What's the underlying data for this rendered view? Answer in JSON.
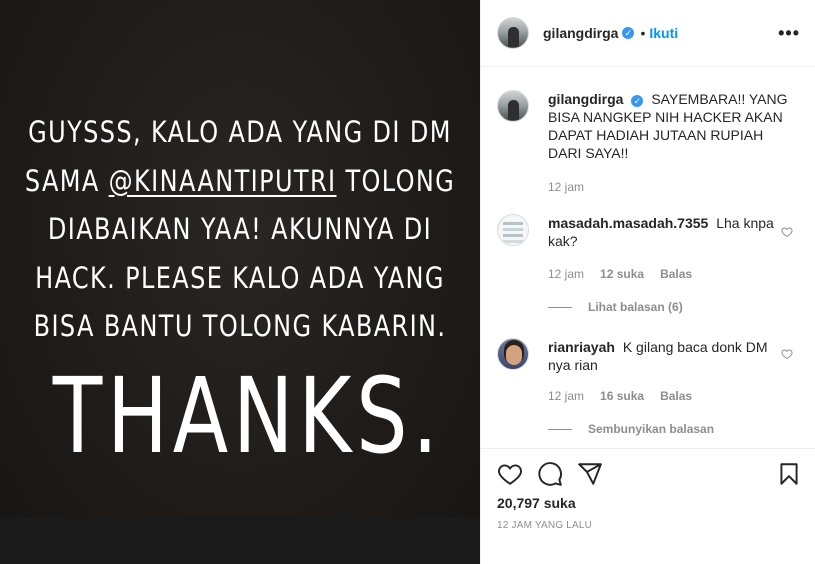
{
  "post": {
    "story_lines": [
      "GUYSSS, KALO ADA YANG DI DM",
      "SAMA",
      "@KINAANTIPUTRI",
      "TOLONG",
      "DIABAIKAN YAA! AKUNNYA DI",
      "HACK. PLEASE KALO ADA YANG",
      "BISA BANTU TOLONG KABARIN."
    ],
    "thanks": "THANKS."
  },
  "header": {
    "username": "gilangdirga",
    "verified": "✓",
    "separator": "•",
    "follow_label": "Ikuti",
    "more_label": "•••"
  },
  "caption": {
    "username": "gilangdirga",
    "verified": "✓",
    "text": "SAYEMBARA!! YANG BISA NANGKEP NIH HACKER AKAN DAPAT HADIAH JUTAAN RUPIAH DARI SAYA!!",
    "time": "12 jam"
  },
  "comments": [
    {
      "username": "masadah.masadah.7355",
      "text": "Lha knpa kak?",
      "time": "12 jam",
      "likes": "12 suka",
      "reply_label": "Balas",
      "replies_toggle": "Lihat balasan (6)"
    },
    {
      "username": "rianriayah",
      "text": "K gilang baca donk DM nya rian",
      "time": "12 jam",
      "likes": "16 suka",
      "reply_label": "Balas",
      "replies_toggle": "Sembunyikan balasan"
    }
  ],
  "actions": {
    "icons": [
      "heart-icon",
      "comment-icon",
      "share-icon",
      "bookmark-icon"
    ],
    "likes_count": "20,797 suka",
    "time_ago": "12 JAM YANG LALU"
  },
  "colors": {
    "link_blue": "#0095f6",
    "verified_blue": "#3897f0",
    "muted": "#8e8e8e",
    "text": "#262626",
    "photo_bg": "#1f1c1a"
  }
}
